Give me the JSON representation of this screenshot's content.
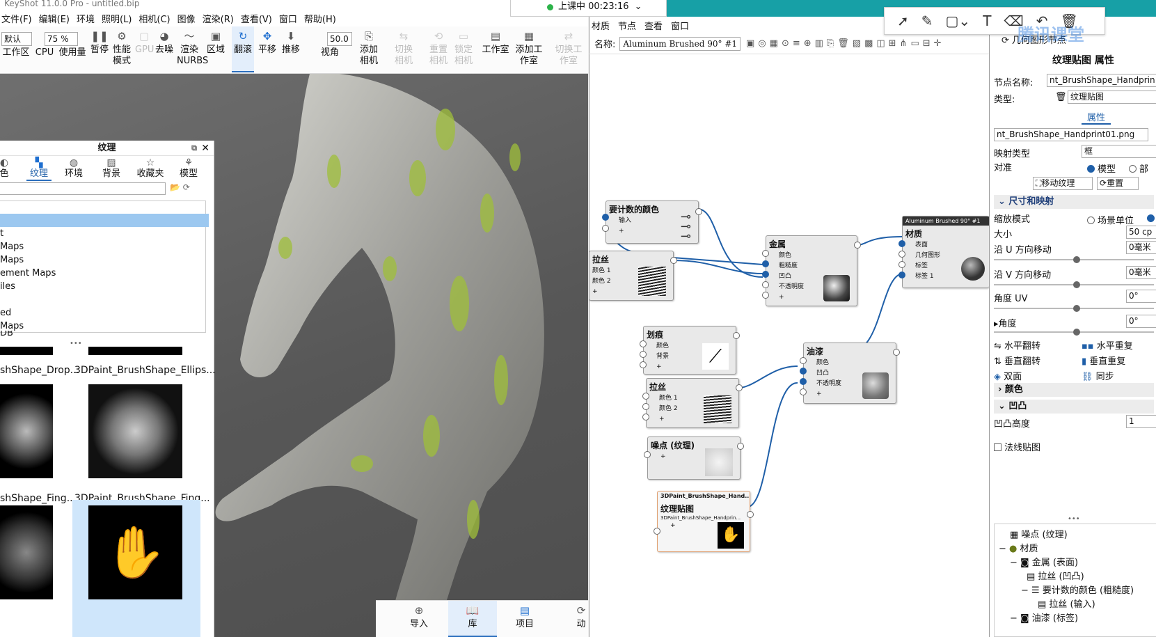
{
  "app": {
    "title": "KeyShot 11.0.0 Pro - untitled.bip"
  },
  "menu": [
    "文件(F)",
    "编辑(E)",
    "环境",
    "照明(L)",
    "相机(C)",
    "图像",
    "渲染(R)",
    "查看(V)",
    "窗口",
    "帮助(H)"
  ],
  "toolbar": {
    "preset": "默认",
    "zoom": "75 %",
    "fov": "50.0",
    "items": [
      "工作区",
      "CPU",
      "使用量",
      "暂停",
      "性能模式",
      "GPU",
      "去噪",
      "渲染NURBS",
      "区域",
      "翻滚",
      "平移",
      "推移",
      "视角",
      "添加相机",
      "切换相机",
      "重置相机",
      "锁定相机",
      "工作室",
      "添加工作室",
      "切换工作室"
    ]
  },
  "recording": {
    "label": "上课中 00:23:16"
  },
  "library": {
    "title": "纹理",
    "tabs": [
      "色",
      "纹理",
      "环境",
      "背景",
      "收藏夹",
      "模型"
    ],
    "tree": [
      "t",
      "Maps",
      "Maps",
      "ement Maps",
      "iles",
      "ed",
      "Maps",
      "DB"
    ],
    "thumbs": [
      "shShape_Drop...",
      "3DPaint_BrushShape_Ellips...",
      "shShape_Fing...",
      "3DPaint_BrushShape_Fing..."
    ]
  },
  "bottombar": [
    "导入",
    "库",
    "项目",
    "动"
  ],
  "node_editor": {
    "menu": [
      "材质",
      "节点",
      "查看",
      "窗口"
    ],
    "name_label": "名称:",
    "name_value": "Aluminum Brushed 90° #1",
    "nodes": {
      "color": {
        "title": "要计数的颜色",
        "rows": [
          "输入",
          "+"
        ]
      },
      "brushed_top": {
        "title": "拉丝",
        "rows": [
          "颜色 1",
          "颜色 2",
          "+"
        ]
      },
      "metal": {
        "title": "金属",
        "rows": [
          "颜色",
          "粗糙度",
          "凹凸",
          "不透明度",
          "+"
        ]
      },
      "material": {
        "header": "Aluminum Brushed 90° #1",
        "title": "材质",
        "rows": [
          "表面",
          "几何图形",
          "标签",
          "标签 1"
        ]
      },
      "scratch": {
        "title": "划痕",
        "rows": [
          "颜色",
          "背景",
          "+"
        ]
      },
      "paint": {
        "title": "油漆",
        "rows": [
          "颜色",
          "凹凸",
          "不透明度",
          "+"
        ]
      },
      "brushed2": {
        "title": "拉丝",
        "rows": [
          "颜色 1",
          "颜色 2",
          "+"
        ]
      },
      "noise": {
        "title": "噪点 (纹理)",
        "rows": [
          "+"
        ]
      },
      "texmap": {
        "header": "3DPaint_BrushShape_Hand...",
        "title": "纹理贴图",
        "sub": "3DPaint_BrushShape_Handprin...",
        "rows": [
          "+"
        ]
      }
    }
  },
  "props": {
    "geo_btn": "几何图形节点",
    "title": "纹理贴图 属性",
    "node_name_label": "节点名称:",
    "node_name": "nt_BrushShape_Handprin",
    "type_label": "类型:",
    "type": "纹理贴图",
    "tab": "属性",
    "file": "nt_BrushShape_Handprint01.png",
    "map_type_label": "映射类型",
    "map_type": "框",
    "align_label": "对准",
    "align_opt1": "模型",
    "align_opt2": "部",
    "move_btn": "移动纹理",
    "reset_btn": "重置",
    "size_section": "尺寸和映射",
    "scale_mode_label": "缩放模式",
    "scale_opt1": "场景单位",
    "size_label": "大小",
    "size": "50 cp",
    "u_label": "沿 U 方向移动",
    "u_val": "0毫米",
    "v_label": "沿 V 方向移动",
    "v_val": "0毫米",
    "uv_label": "角度 UV",
    "uv_val": "0°",
    "angle_label": "角度",
    "angle_val": "0°",
    "hflip": "水平翻转",
    "hrep": "水平重复",
    "vflip": "垂直翻转",
    "vrep": "垂直重复",
    "double": "双面",
    "sync": "同步",
    "color_section": "颜色",
    "bump_section": "凹凸",
    "bump_height_label": "凹凸高度",
    "bump_height": "1",
    "normal_map": "法线贴图",
    "tree": [
      "噪点 (纹理)",
      "材质",
      "金属 (表面)",
      "拉丝 (凹凸)",
      "要计数的颜色 (粗糙度)",
      "拉丝 (输入)",
      "油漆 (标签)"
    ]
  },
  "watermark": "腾讯课堂"
}
